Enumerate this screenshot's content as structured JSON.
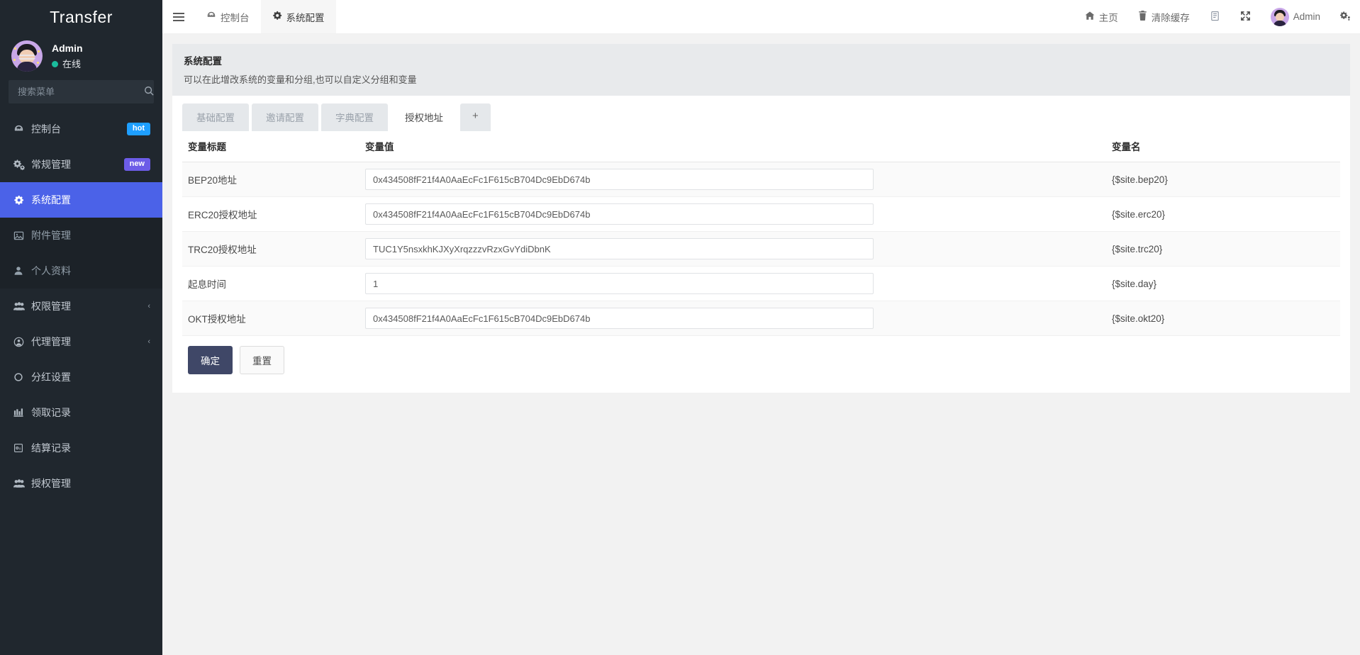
{
  "sidebar": {
    "brand": "Transfer",
    "user": {
      "name": "Admin",
      "status": "在线"
    },
    "search": {
      "placeholder": "搜索菜单",
      "value": "",
      "icon": "search-icon"
    },
    "items": [
      {
        "label": "控制台",
        "icon": "dashboard-icon",
        "badge": "hot",
        "badge_type": "hot",
        "state": "normal"
      },
      {
        "label": "常规管理",
        "icon": "gears-icon",
        "badge": "new",
        "badge_type": "new",
        "state": "normal"
      },
      {
        "label": "系统配置",
        "icon": "gear-icon",
        "badge": "",
        "state": "active"
      },
      {
        "label": "附件管理",
        "icon": "image-icon",
        "badge": "",
        "state": "muted"
      },
      {
        "label": "个人资料",
        "icon": "user-icon",
        "badge": "",
        "state": "muted"
      },
      {
        "label": "权限管理",
        "icon": "users-icon",
        "badge": "",
        "state": "normal",
        "chevron": "‹"
      },
      {
        "label": "代理管理",
        "icon": "user-circle-icon",
        "badge": "",
        "state": "normal",
        "chevron": "‹"
      },
      {
        "label": "分红设置",
        "icon": "circle-icon",
        "badge": "",
        "state": "normal"
      },
      {
        "label": "领取记录",
        "icon": "chart-icon",
        "badge": "",
        "state": "normal"
      },
      {
        "label": "结算记录",
        "icon": "calculator-icon",
        "badge": "",
        "state": "normal"
      },
      {
        "label": "授权管理",
        "icon": "users-icon",
        "badge": "",
        "state": "normal"
      }
    ]
  },
  "topbar": {
    "menu_toggle_icon": "hamburger-icon",
    "tabs": [
      {
        "label": "控制台",
        "icon": "dashboard-icon",
        "selected": false
      },
      {
        "label": "系统配置",
        "icon": "gear-icon",
        "selected": true
      }
    ],
    "right": [
      {
        "label": "主页",
        "icon": "home-icon"
      },
      {
        "label": "清除缓存",
        "icon": "trash-icon"
      },
      {
        "label": "",
        "icon": "note-icon"
      },
      {
        "label": "",
        "icon": "fullscreen-icon"
      },
      {
        "label": "Admin",
        "icon": "avatar-icon"
      },
      {
        "label": "",
        "icon": "settings-gear-icon"
      }
    ]
  },
  "panel": {
    "title": "系统配置",
    "subtitle": "可以在此增改系统的变量和分组,也可以自定义分组和变量"
  },
  "tabs": [
    {
      "label": "基础配置",
      "active": false
    },
    {
      "label": "邀请配置",
      "active": false
    },
    {
      "label": "字典配置",
      "active": false
    },
    {
      "label": "授权地址",
      "active": true
    },
    {
      "label": "+",
      "active": false,
      "is_add": true
    }
  ],
  "table": {
    "headers": [
      "变量标题",
      "变量值",
      "变量名"
    ],
    "rows": [
      {
        "title": "BEP20地址",
        "value": "0x434508fF21f4A0AaEcFc1F615cB704Dc9EbD674b",
        "name": "{$site.bep20}"
      },
      {
        "title": "ERC20授权地址",
        "value": "0x434508fF21f4A0AaEcFc1F615cB704Dc9EbD674b",
        "name": "{$site.erc20}"
      },
      {
        "title": "TRC20授权地址",
        "value": "TUC1Y5nsxkhKJXyXrqzzzvRzxGvYdiDbnK",
        "name": "{$site.trc20}"
      },
      {
        "title": "起息时间",
        "value": "1",
        "name": "{$site.day}"
      },
      {
        "title": "OKT授权地址",
        "value": "0x434508fF21f4A0AaEcFc1F615cB704Dc9EbD674b",
        "name": "{$site.okt20}"
      }
    ]
  },
  "actions": {
    "submit": "确定",
    "reset": "重置"
  },
  "colors": {
    "sidebar_bg": "#20272e",
    "active_menu": "#4b62e8",
    "badge_hot": "#1e9fff",
    "badge_new": "#6c5ce7",
    "primary_button": "#3f4767",
    "online_dot": "#1abc9c"
  }
}
